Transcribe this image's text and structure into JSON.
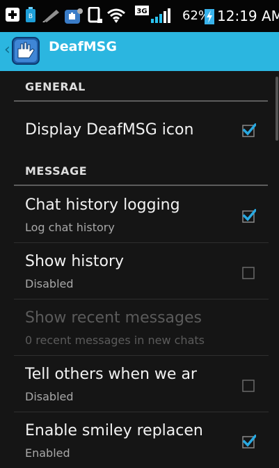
{
  "status_bar": {
    "battery_percent": "62%",
    "network_badge": "3G",
    "time": "12:19 AM",
    "icons": [
      "add-box-icon",
      "battery-saver-icon",
      "pen-icon",
      "deafmsg-notification-icon",
      "nfc-icon",
      "wifi-icon",
      "network-3g-icon",
      "signal-icon",
      "charging-icon"
    ]
  },
  "action_bar": {
    "title": "DeafMSG",
    "icons": [
      "back-caret-icon",
      "deafmsg-app-icon"
    ]
  },
  "sections": {
    "general": "GENERAL",
    "message": "MESSAGE"
  },
  "preferences": [
    {
      "title": "Display DeafMSG icon",
      "summary": "",
      "checked": true,
      "enabled": true
    },
    {
      "title": "Chat history logging",
      "summary": "Log chat history",
      "checked": true,
      "enabled": true
    },
    {
      "title": "Show history",
      "summary": "Disabled",
      "checked": false,
      "enabled": true
    },
    {
      "title": "Show recent messages",
      "summary": "0 recent messages in new chats",
      "checked": null,
      "enabled": false
    },
    {
      "title": "Tell others when we ar",
      "summary": "Disabled",
      "checked": false,
      "enabled": true
    },
    {
      "title": "Enable smiley replacen",
      "summary": "Enabled",
      "checked": true,
      "enabled": true
    }
  ],
  "colors": {
    "accent": "#2bb6e0",
    "check": "#29a9e1",
    "background": "#151515",
    "status_bar": "#050505"
  }
}
